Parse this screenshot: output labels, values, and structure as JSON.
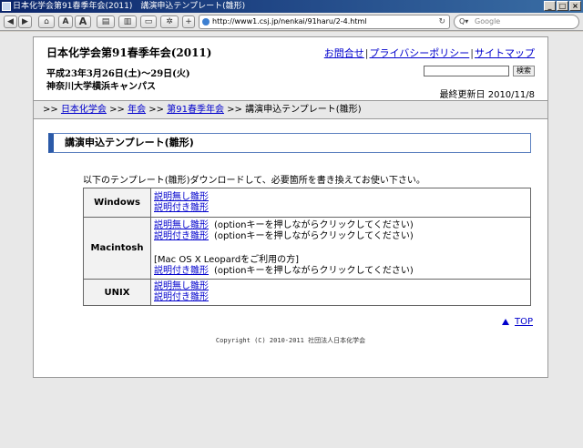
{
  "window": {
    "title": "日本化学会第91春季年会(2011)　講演申込テンプレート(雛形)"
  },
  "browser": {
    "url": "http://www1.csj.jp/nenkai/91haru/2-4.html",
    "search_placeholder": "Google",
    "font_smaller": "A",
    "font_larger": "A"
  },
  "header": {
    "site_title": "日本化学会第91春季年会(2011)",
    "links": [
      "お問合せ",
      "プライバシーポリシー",
      "サイトマップ"
    ],
    "dates": "平成23年3月26日(土)〜29日(火)",
    "venue": "神奈川大学横浜キャンパス",
    "search_button": "検索",
    "updated": "最終更新日 2010/11/8"
  },
  "breadcrumb": {
    "prefix": ">> ",
    "items": [
      "日本化学会",
      "年会",
      "第91春季年会"
    ],
    "current": "講演申込テンプレート(雛形)"
  },
  "main": {
    "heading": "講演申込テンプレート(雛形)",
    "intro": "以下のテンプレート(雛形)ダウンロードして、必要箇所を書き換えてお使い下さい。",
    "rows": [
      {
        "os": "Windows",
        "lines": [
          {
            "link": "説明無し雛形",
            "note": ""
          },
          {
            "link": "説明付き雛形",
            "note": ""
          }
        ]
      },
      {
        "os": "Macintosh",
        "lines": [
          {
            "link": "説明無し雛形",
            "note": "(optionキーを押しながらクリックしてください)"
          },
          {
            "link": "説明付き雛形",
            "note": "(optionキーを押しながらクリックしてください)"
          },
          {
            "text": "[Mac OS X Leopardをご利用の方]"
          },
          {
            "link": "説明付き雛形",
            "note": "(optionキーを押しながらクリックしてください)"
          }
        ]
      },
      {
        "os": "UNIX",
        "lines": [
          {
            "link": "説明無し雛形",
            "note": ""
          },
          {
            "link": "説明付き雛形",
            "note": ""
          }
        ]
      }
    ],
    "top_link": "TOP"
  },
  "footer": {
    "copyright": "Copyright (C) 2010-2011 社団法人日本化学会"
  }
}
